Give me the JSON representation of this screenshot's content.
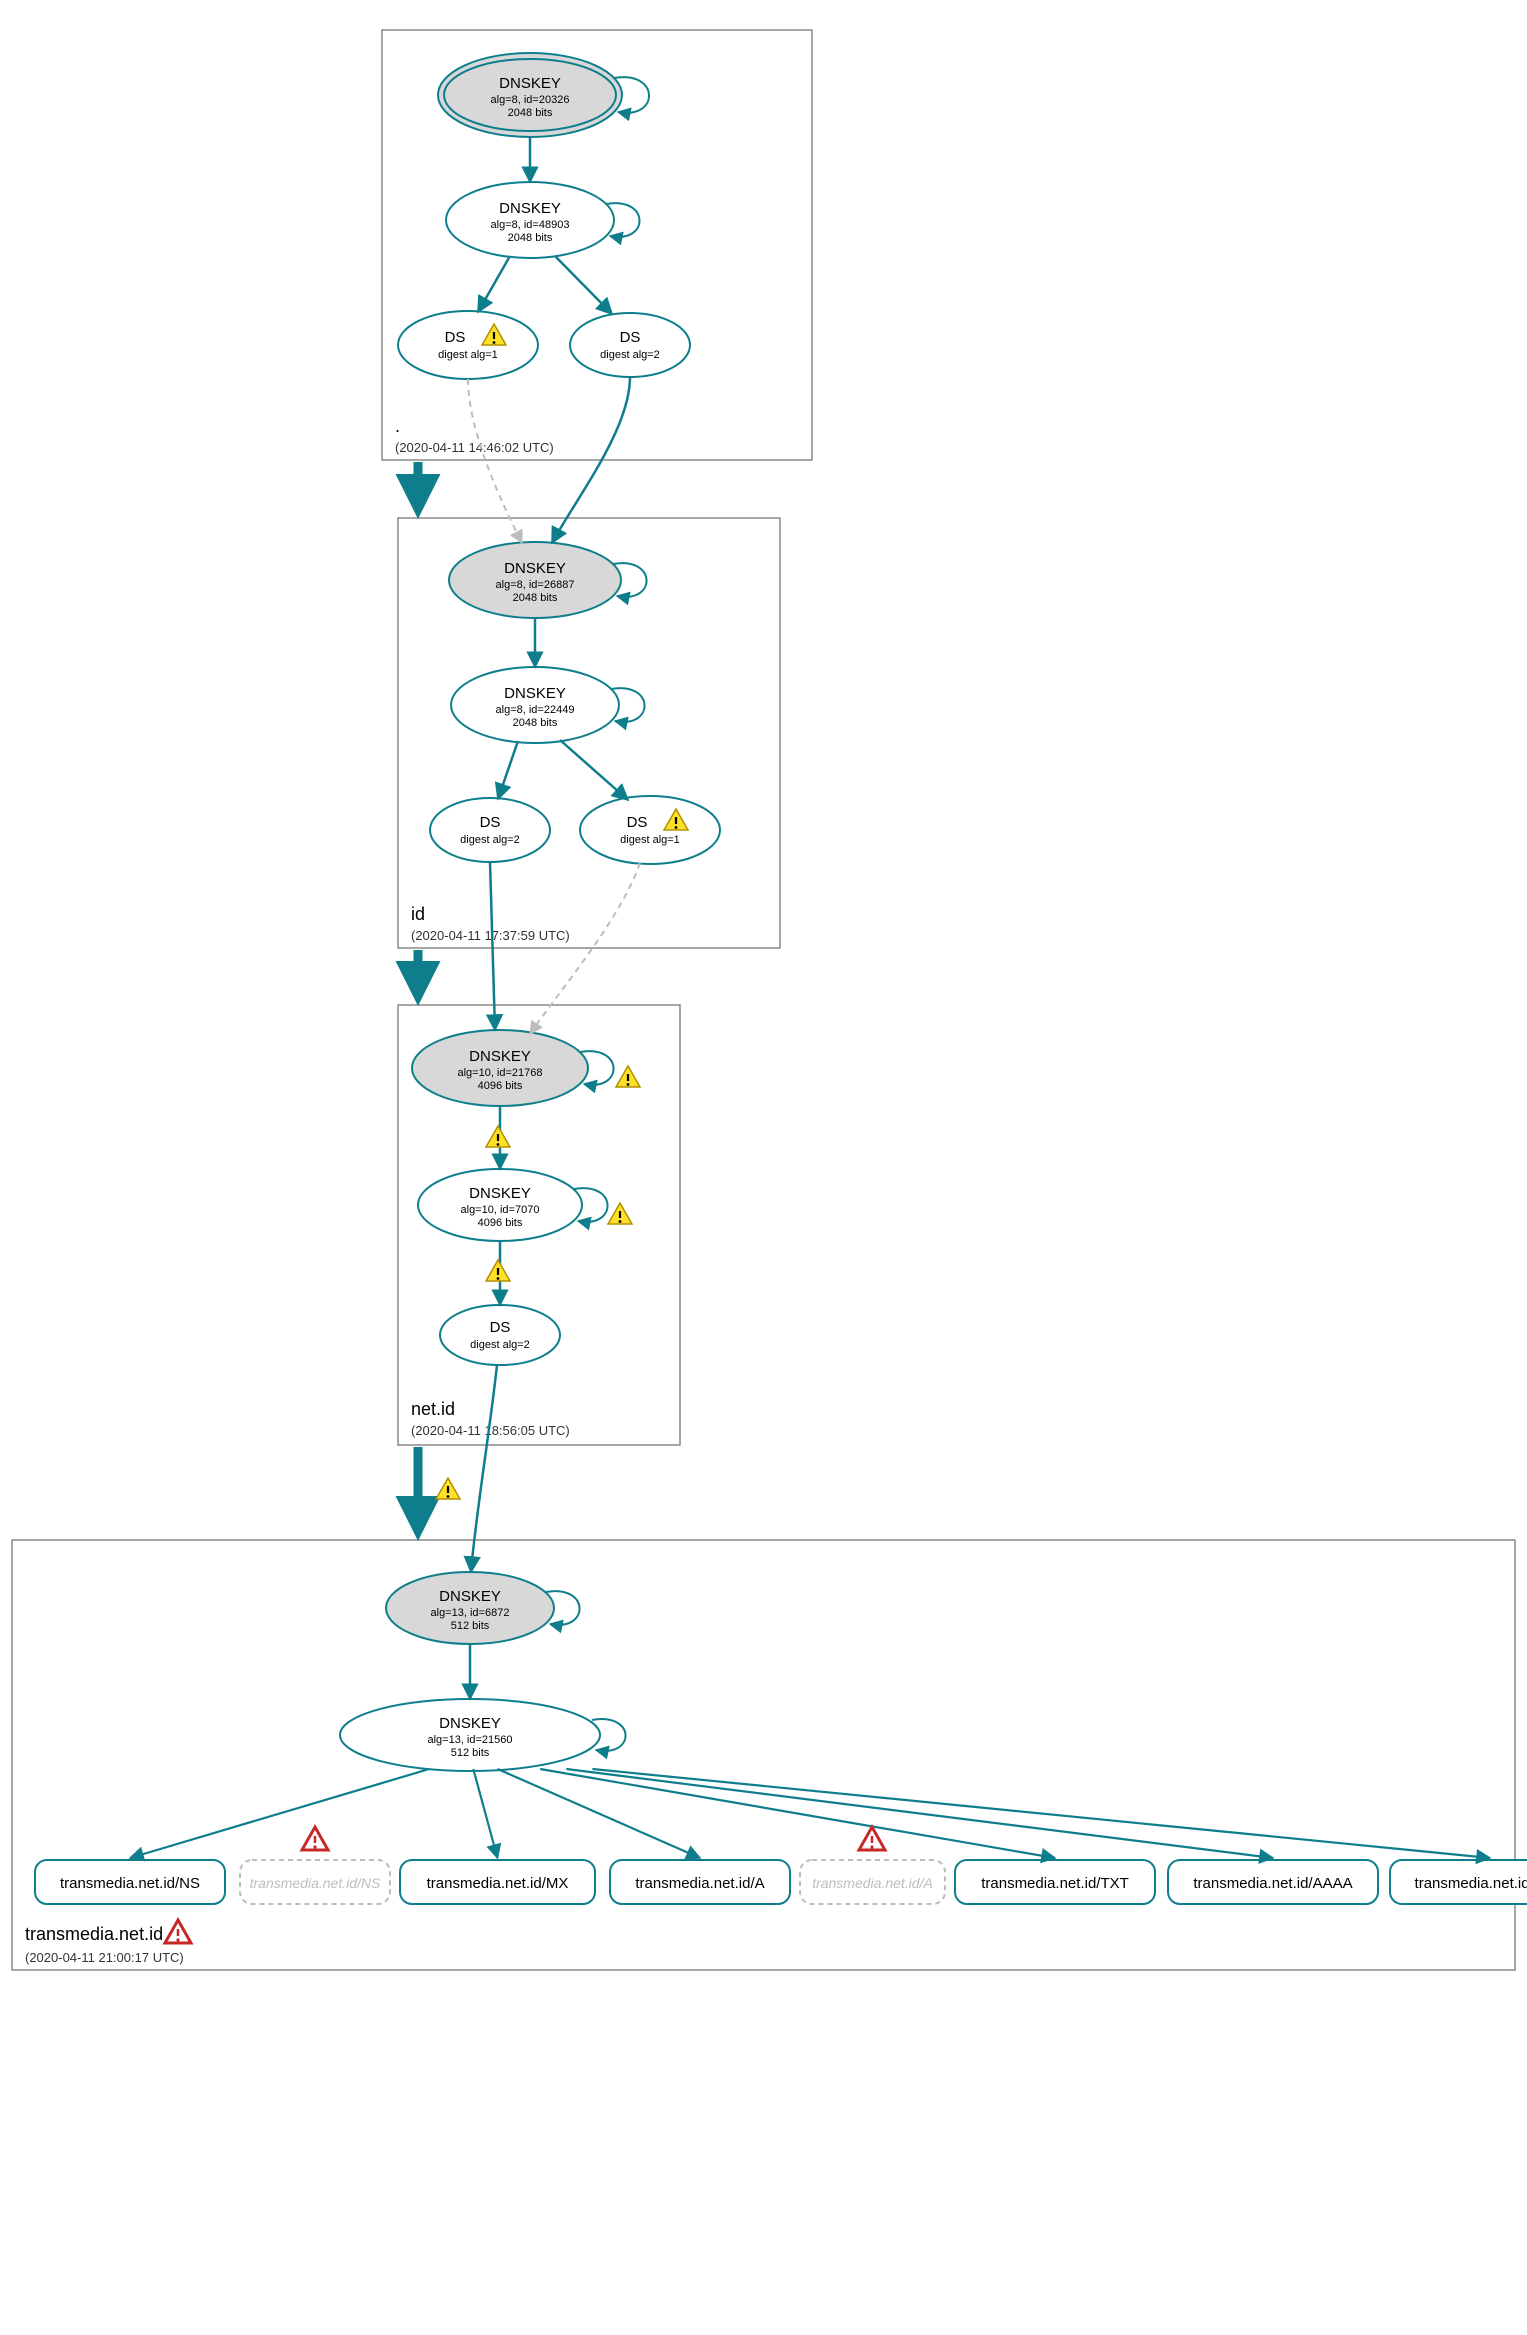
{
  "colors": {
    "teal": "#0e7e8d",
    "zone": "#888",
    "grey": "#bdbdbd",
    "keyFill": "#d8d8d8",
    "warnFill": "#ffe029",
    "warnStroke": "#b38f00",
    "errStroke": "#c62828"
  },
  "zones": [
    {
      "id": "root",
      "label": ".",
      "ts": "(2020-04-11 14:46:02 UTC)"
    },
    {
      "id": "id",
      "label": "id",
      "ts": "(2020-04-11 17:37:59 UTC)"
    },
    {
      "id": "netid",
      "label": "net.id",
      "ts": "(2020-04-11 18:56:05 UTC)"
    },
    {
      "id": "leaf",
      "label": "transmedia.net.id",
      "ts": "(2020-04-11 21:00:17 UTC)"
    }
  ],
  "nodes": {
    "root_ksk": {
      "t": "DNSKEY",
      "l1": "alg=8, id=20326",
      "l2": "2048 bits"
    },
    "root_zsk": {
      "t": "DNSKEY",
      "l1": "alg=8, id=48903",
      "l2": "2048 bits"
    },
    "root_ds1": {
      "t": "DS",
      "l1": "digest alg=1",
      "warn": true
    },
    "root_ds2": {
      "t": "DS",
      "l1": "digest alg=2"
    },
    "id_ksk": {
      "t": "DNSKEY",
      "l1": "alg=8, id=26887",
      "l2": "2048 bits"
    },
    "id_zsk": {
      "t": "DNSKEY",
      "l1": "alg=8, id=22449",
      "l2": "2048 bits"
    },
    "id_ds2": {
      "t": "DS",
      "l1": "digest alg=2"
    },
    "id_ds1": {
      "t": "DS",
      "l1": "digest alg=1",
      "warn": true
    },
    "net_ksk": {
      "t": "DNSKEY",
      "l1": "alg=10, id=21768",
      "l2": "4096 bits"
    },
    "net_zsk": {
      "t": "DNSKEY",
      "l1": "alg=10, id=7070",
      "l2": "4096 bits"
    },
    "net_ds": {
      "t": "DS",
      "l1": "digest alg=2"
    },
    "leaf_ksk": {
      "t": "DNSKEY",
      "l1": "alg=13, id=6872",
      "l2": "512 bits"
    },
    "leaf_zsk": {
      "t": "DNSKEY",
      "l1": "alg=13, id=21560",
      "l2": "512 bits"
    }
  },
  "rrsets": [
    {
      "id": "rr_ns",
      "label": "transmedia.net.id/NS"
    },
    {
      "id": "rr_ns_g",
      "label": "transmedia.net.id/NS",
      "grey": true
    },
    {
      "id": "rr_mx",
      "label": "transmedia.net.id/MX"
    },
    {
      "id": "rr_a",
      "label": "transmedia.net.id/A"
    },
    {
      "id": "rr_a_g",
      "label": "transmedia.net.id/A",
      "grey": true
    },
    {
      "id": "rr_txt",
      "label": "transmedia.net.id/TXT"
    },
    {
      "id": "rr_aaaa",
      "label": "transmedia.net.id/AAAA"
    },
    {
      "id": "rr_soa",
      "label": "transmedia.net.id/SOA"
    }
  ],
  "chart_data": {
    "type": "graph",
    "description": "DNSSEC delegation / authentication chain for transmedia.net.id",
    "zones": [
      ".",
      "id",
      "net.id",
      "transmedia.net.id"
    ],
    "nodes": [
      {
        "id": "root_ksk",
        "zone": ".",
        "type": "DNSKEY",
        "alg": 8,
        "key_id": 20326,
        "bits": 2048,
        "role": "KSK",
        "trust_anchor": true,
        "self_loop": true
      },
      {
        "id": "root_zsk",
        "zone": ".",
        "type": "DNSKEY",
        "alg": 8,
        "key_id": 48903,
        "bits": 2048,
        "role": "ZSK",
        "self_loop": true
      },
      {
        "id": "root_ds1",
        "zone": ".",
        "type": "DS",
        "digest_alg": 1,
        "warning": true
      },
      {
        "id": "root_ds2",
        "zone": ".",
        "type": "DS",
        "digest_alg": 2
      },
      {
        "id": "id_ksk",
        "zone": "id",
        "type": "DNSKEY",
        "alg": 8,
        "key_id": 26887,
        "bits": 2048,
        "role": "KSK",
        "self_loop": true
      },
      {
        "id": "id_zsk",
        "zone": "id",
        "type": "DNSKEY",
        "alg": 8,
        "key_id": 22449,
        "bits": 2048,
        "role": "ZSK",
        "self_loop": true
      },
      {
        "id": "id_ds2",
        "zone": "id",
        "type": "DS",
        "digest_alg": 2
      },
      {
        "id": "id_ds1",
        "zone": "id",
        "type": "DS",
        "digest_alg": 1,
        "warning": true
      },
      {
        "id": "net_ksk",
        "zone": "net.id",
        "type": "DNSKEY",
        "alg": 10,
        "key_id": 21768,
        "bits": 4096,
        "role": "KSK",
        "self_loop": true,
        "self_loop_warning": true
      },
      {
        "id": "net_zsk",
        "zone": "net.id",
        "type": "DNSKEY",
        "alg": 10,
        "key_id": 7070,
        "bits": 4096,
        "role": "ZSK",
        "self_loop": true,
        "self_loop_warning": true
      },
      {
        "id": "net_ds",
        "zone": "net.id",
        "type": "DS",
        "digest_alg": 2
      },
      {
        "id": "leaf_ksk",
        "zone": "transmedia.net.id",
        "type": "DNSKEY",
        "alg": 13,
        "key_id": 6872,
        "bits": 512,
        "role": "KSK",
        "self_loop": true
      },
      {
        "id": "leaf_zsk",
        "zone": "transmedia.net.id",
        "type": "DNSKEY",
        "alg": 13,
        "key_id": 21560,
        "bits": 512,
        "role": "ZSK",
        "self_loop": true
      },
      {
        "id": "rr_ns",
        "zone": "transmedia.net.id",
        "type": "RRset",
        "name": "transmedia.net.id/NS"
      },
      {
        "id": "rr_ns_g",
        "zone": "transmedia.net.id",
        "type": "RRset",
        "name": "transmedia.net.id/NS",
        "status": "insecure",
        "error": true
      },
      {
        "id": "rr_mx",
        "zone": "transmedia.net.id",
        "type": "RRset",
        "name": "transmedia.net.id/MX"
      },
      {
        "id": "rr_a",
        "zone": "transmedia.net.id",
        "type": "RRset",
        "name": "transmedia.net.id/A"
      },
      {
        "id": "rr_a_g",
        "zone": "transmedia.net.id",
        "type": "RRset",
        "name": "transmedia.net.id/A",
        "status": "insecure",
        "error": true
      },
      {
        "id": "rr_txt",
        "zone": "transmedia.net.id",
        "type": "RRset",
        "name": "transmedia.net.id/TXT"
      },
      {
        "id": "rr_aaaa",
        "zone": "transmedia.net.id",
        "type": "RRset",
        "name": "transmedia.net.id/AAAA"
      },
      {
        "id": "rr_soa",
        "zone": "transmedia.net.id",
        "type": "RRset",
        "name": "transmedia.net.id/SOA"
      }
    ],
    "edges": [
      {
        "from": "root_ksk",
        "to": "root_zsk",
        "kind": "signs"
      },
      {
        "from": "root_zsk",
        "to": "root_ds1",
        "kind": "signs"
      },
      {
        "from": "root_zsk",
        "to": "root_ds2",
        "kind": "signs"
      },
      {
        "from": "root_ds1",
        "to": "id_ksk",
        "kind": "delegation",
        "style": "dashed-grey"
      },
      {
        "from": "root_ds2",
        "to": "id_ksk",
        "kind": "delegation"
      },
      {
        "from": "id_ksk",
        "to": "id_zsk",
        "kind": "signs"
      },
      {
        "from": "id_zsk",
        "to": "id_ds2",
        "kind": "signs"
      },
      {
        "from": "id_zsk",
        "to": "id_ds1",
        "kind": "signs"
      },
      {
        "from": "id_ds2",
        "to": "net_ksk",
        "kind": "delegation"
      },
      {
        "from": "id_ds1",
        "to": "net_ksk",
        "kind": "delegation",
        "style": "dashed-grey"
      },
      {
        "from": "net_ksk",
        "to": "net_zsk",
        "kind": "signs",
        "warning": true
      },
      {
        "from": "net_zsk",
        "to": "net_ds",
        "kind": "signs",
        "warning": true
      },
      {
        "from": "net_ds",
        "to": "leaf_ksk",
        "kind": "delegation",
        "warning": true
      },
      {
        "from": "leaf_ksk",
        "to": "leaf_zsk",
        "kind": "signs"
      },
      {
        "from": "leaf_zsk",
        "to": "rr_ns",
        "kind": "signs"
      },
      {
        "from": "leaf_zsk",
        "to": "rr_mx",
        "kind": "signs"
      },
      {
        "from": "leaf_zsk",
        "to": "rr_a",
        "kind": "signs"
      },
      {
        "from": "leaf_zsk",
        "to": "rr_txt",
        "kind": "signs"
      },
      {
        "from": "leaf_zsk",
        "to": "rr_aaaa",
        "kind": "signs"
      },
      {
        "from": "leaf_zsk",
        "to": "rr_soa",
        "kind": "signs"
      }
    ],
    "zone_edges": [
      {
        "from": ".",
        "to": "id"
      },
      {
        "from": "id",
        "to": "net.id"
      },
      {
        "from": "net.id",
        "to": "transmedia.net.id"
      }
    ],
    "zone_timestamps": {
      ".": "2020-04-11 14:46:02 UTC",
      "id": "2020-04-11 17:37:59 UTC",
      "net.id": "2020-04-11 18:56:05 UTC",
      "transmedia.net.id": "2020-04-11 21:00:17 UTC"
    }
  }
}
